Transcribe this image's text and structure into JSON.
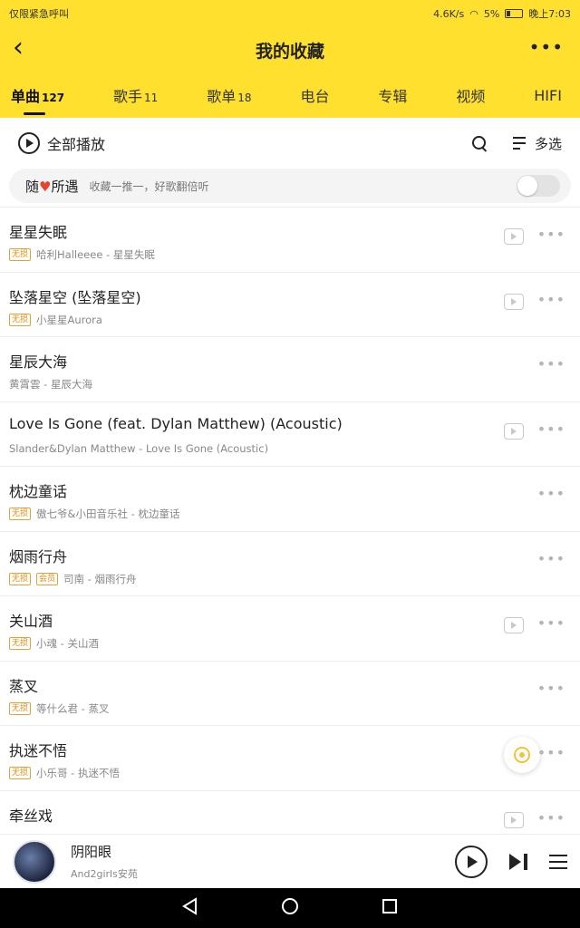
{
  "status_bar": {
    "left_text": "仅限紧急呼叫",
    "net_speed": "4.6K/s",
    "battery": "5%",
    "time": "晚上7:03"
  },
  "header": {
    "title": "我的收藏"
  },
  "tabs": [
    {
      "label": "单曲",
      "count": "127"
    },
    {
      "label": "歌手",
      "count": "11"
    },
    {
      "label": "歌单",
      "count": "18"
    },
    {
      "label": "电台",
      "count": ""
    },
    {
      "label": "专辑",
      "count": ""
    },
    {
      "label": "视频",
      "count": ""
    },
    {
      "label": "HIFI",
      "count": ""
    }
  ],
  "actions": {
    "play_all": "全部播放",
    "multi_select": "多选"
  },
  "random_encounter": {
    "title_left": "随",
    "title_right": "所遇",
    "subtitle": "收藏一推一，好歌翻倍听"
  },
  "songs": [
    {
      "title": "星星失眠",
      "badges": [
        "无损"
      ],
      "meta": "哈利Halleeee - 星星失眠",
      "has_mv": true
    },
    {
      "title": "坠落星空 (坠落星空)",
      "badges": [
        "无损"
      ],
      "meta": "小星星Aurora",
      "has_mv": true
    },
    {
      "title": "星辰大海",
      "badges": [],
      "meta": "黄霄雲 - 星辰大海",
      "has_mv": false
    },
    {
      "title": "Love Is Gone (feat. Dylan Matthew) (Acoustic)",
      "badges": [],
      "meta": "Slander&Dylan Matthew - Love Is Gone (Acoustic)",
      "has_mv": true
    },
    {
      "title": "枕边童话",
      "badges": [
        "无损"
      ],
      "meta": "傲七爷&小田音乐社 - 枕边童话",
      "has_mv": false
    },
    {
      "title": "烟雨行舟",
      "badges": [
        "无损",
        "会员"
      ],
      "meta": "司南 - 烟雨行舟",
      "has_mv": false
    },
    {
      "title": "关山酒",
      "badges": [
        "无损"
      ],
      "meta": "小魂 - 关山酒",
      "has_mv": true
    },
    {
      "title": "蒸叉",
      "badges": [
        "无损"
      ],
      "meta": "等什么君 - 蒸叉",
      "has_mv": false
    },
    {
      "title": "执迷不悟",
      "badges": [
        "无损"
      ],
      "meta": "小乐哥 - 执迷不悟",
      "has_mv": false
    },
    {
      "title": "牵丝戏",
      "badges": [],
      "meta": "",
      "has_mv": true
    }
  ],
  "player": {
    "title": "阴阳眼",
    "artist": "And2girls安苑"
  },
  "colors": {
    "theme_yellow": "#ffe02e",
    "lossless_badge": "#d88d1a",
    "heart": "#e8412c"
  },
  "icons": {
    "back": "chevron-left-icon",
    "more": "more-horizontal-icon",
    "search": "search-icon",
    "mv": "play-video-icon",
    "locate": "locate-icon"
  }
}
